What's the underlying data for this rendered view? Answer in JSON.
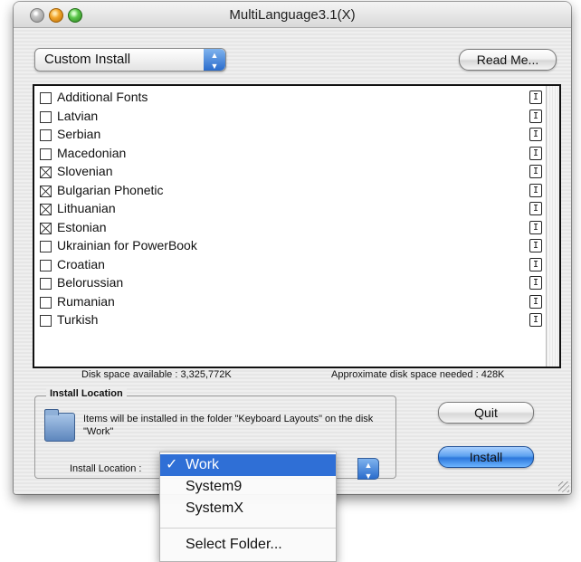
{
  "window": {
    "title": "MultiLanguage3.1(X)"
  },
  "toolbar": {
    "install_type": "Custom Install",
    "read_me_label": "Read Me..."
  },
  "languages": [
    {
      "label": "Additional Fonts",
      "checked": false
    },
    {
      "label": "Latvian",
      "checked": false
    },
    {
      "label": "Serbian",
      "checked": false
    },
    {
      "label": "Macedonian",
      "checked": false
    },
    {
      "label": "Slovenian",
      "checked": true
    },
    {
      "label": "Bulgarian Phonetic",
      "checked": true
    },
    {
      "label": "Lithuanian",
      "checked": true
    },
    {
      "label": "Estonian",
      "checked": true
    },
    {
      "label": "Ukrainian for PowerBook",
      "checked": false
    },
    {
      "label": "Croatian",
      "checked": false
    },
    {
      "label": "Belorussian",
      "checked": false
    },
    {
      "label": "Rumanian",
      "checked": false
    },
    {
      "label": "Turkish",
      "checked": false
    }
  ],
  "info_icon_glyph": "I",
  "disk": {
    "available": "Disk space available : 3,325,772K",
    "needed": "Approximate disk space needed : 428K"
  },
  "install_location": {
    "group_title": "Install Location",
    "description": "Items will be installed in the folder \"Keyboard Layouts\" on the disk \"Work\"",
    "label": "Install Location :"
  },
  "buttons": {
    "quit": "Quit",
    "install": "Install"
  },
  "location_menu": {
    "check_glyph": "✓",
    "items": [
      "Work",
      "System9",
      "SystemX"
    ],
    "selected": "Work",
    "select_folder": "Select Folder..."
  },
  "colors": {
    "accent": "#2f6fd6",
    "window_bg": "#ececec"
  },
  "icons": {
    "folder": "folder-icon",
    "info": "info-icon",
    "popup_arrows": "updown-arrows-icon"
  }
}
